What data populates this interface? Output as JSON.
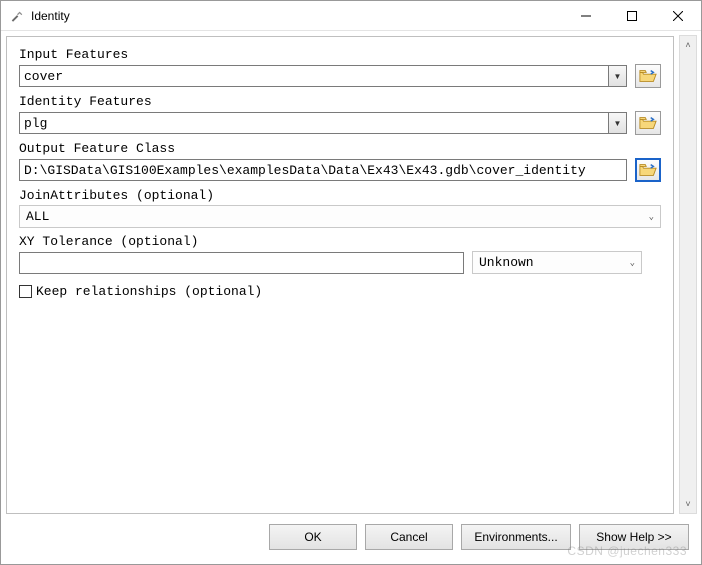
{
  "window": {
    "title": "Identity",
    "icon": "hammer-icon"
  },
  "fields": {
    "input_features": {
      "label": "Input Features",
      "value": "cover"
    },
    "identity_features": {
      "label": "Identity Features",
      "value": "plg"
    },
    "output_feature_class": {
      "label": "Output Feature Class",
      "value": "D:\\GISData\\GIS100Examples\\examplesData\\Data\\Ex43\\Ex43.gdb\\cover_identity"
    },
    "join_attributes": {
      "label": "JoinAttributes (optional)",
      "value": "ALL"
    },
    "xy_tolerance": {
      "label": "XY Tolerance (optional)",
      "value": "",
      "unit": "Unknown"
    },
    "keep_relationships": {
      "label": "Keep relationships (optional)",
      "checked": false
    }
  },
  "buttons": {
    "ok": "OK",
    "cancel": "Cancel",
    "environments": "Environments...",
    "show_help": "Show Help >>"
  },
  "watermark": "CSDN @juechen333"
}
